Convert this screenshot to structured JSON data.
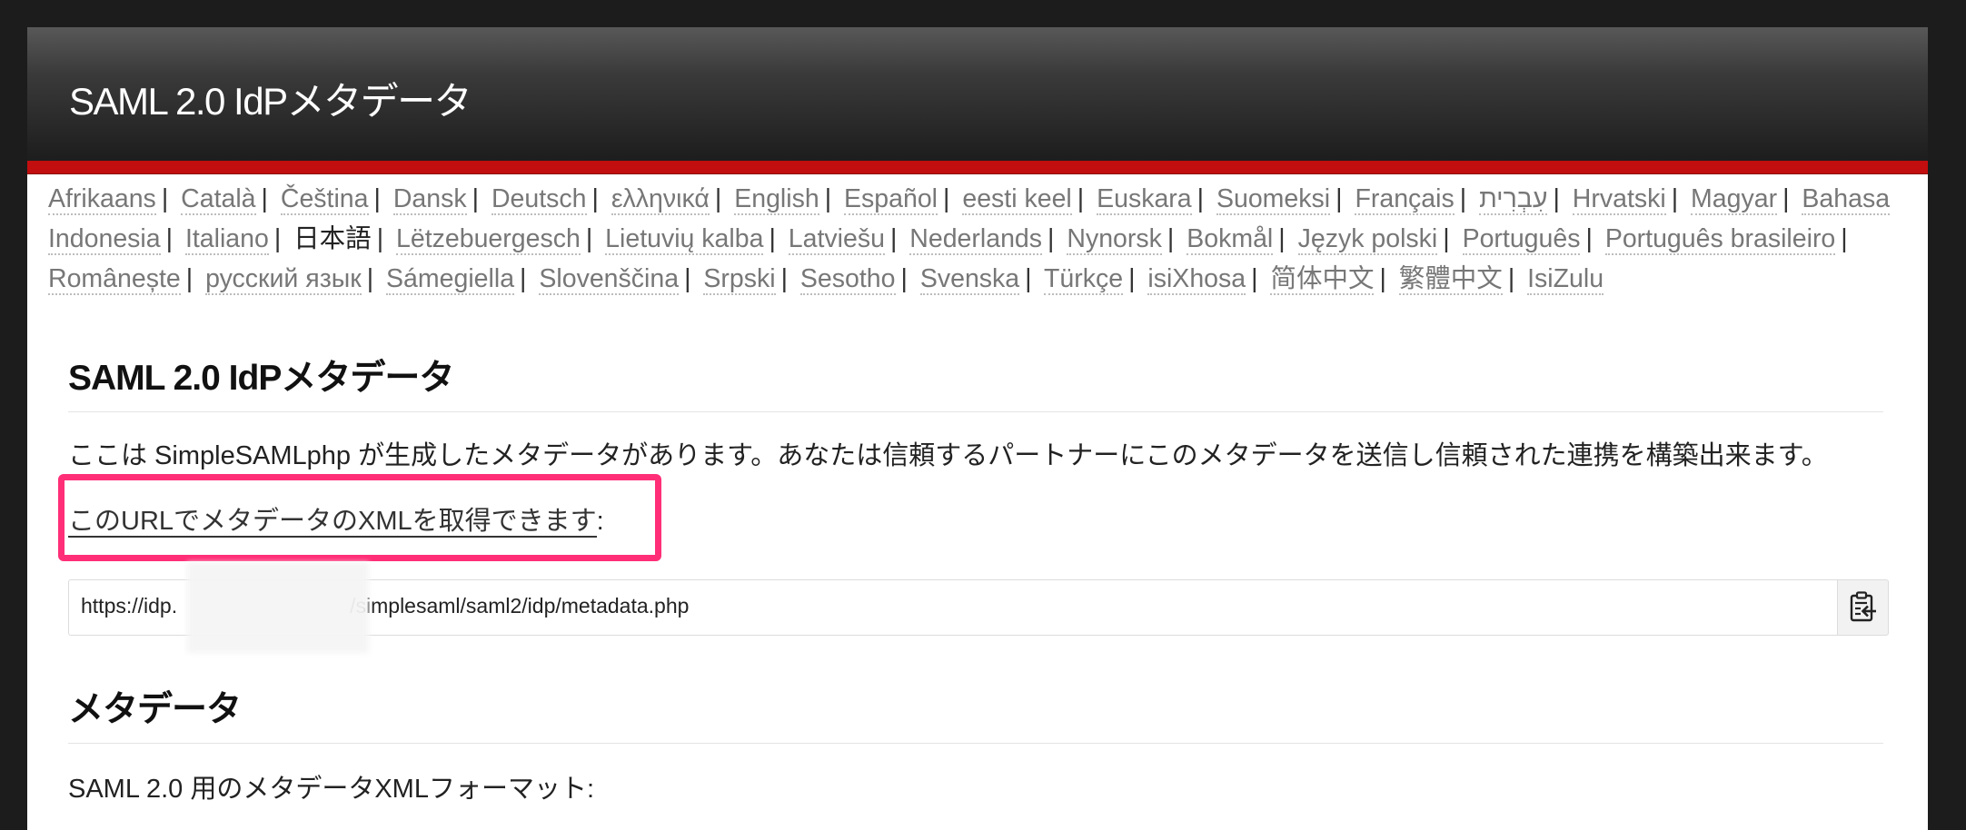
{
  "header": {
    "title": "SAML 2.0 IdPメタデータ"
  },
  "languages": [
    {
      "label": "Afrikaans",
      "current": false
    },
    {
      "label": "Català",
      "current": false
    },
    {
      "label": "Čeština",
      "current": false
    },
    {
      "label": "Dansk",
      "current": false
    },
    {
      "label": "Deutsch",
      "current": false
    },
    {
      "label": "ελληνικά",
      "current": false
    },
    {
      "label": "English",
      "current": false
    },
    {
      "label": "Español",
      "current": false
    },
    {
      "label": "eesti keel",
      "current": false
    },
    {
      "label": "Euskara",
      "current": false
    },
    {
      "label": "Suomeksi",
      "current": false
    },
    {
      "label": "Français",
      "current": false
    },
    {
      "label": "עִבְרִית",
      "current": false
    },
    {
      "label": "Hrvatski",
      "current": false
    },
    {
      "label": "Magyar",
      "current": false
    },
    {
      "label": "Bahasa Indonesia",
      "current": false
    },
    {
      "label": "Italiano",
      "current": false
    },
    {
      "label": "日本語",
      "current": true
    },
    {
      "label": "Lëtzebuergesch",
      "current": false
    },
    {
      "label": "Lietuvių kalba",
      "current": false
    },
    {
      "label": "Latviešu",
      "current": false
    },
    {
      "label": "Nederlands",
      "current": false
    },
    {
      "label": "Nynorsk",
      "current": false
    },
    {
      "label": "Bokmål",
      "current": false
    },
    {
      "label": "Język polski",
      "current": false
    },
    {
      "label": "Português",
      "current": false
    },
    {
      "label": "Português brasileiro",
      "current": false
    },
    {
      "label": "Românește",
      "current": false
    },
    {
      "label": "русский язык",
      "current": false
    },
    {
      "label": "Sámegiella",
      "current": false
    },
    {
      "label": "Slovenščina",
      "current": false
    },
    {
      "label": "Srpski",
      "current": false
    },
    {
      "label": "Sesotho",
      "current": false
    },
    {
      "label": "Svenska",
      "current": false
    },
    {
      "label": "Türkçe",
      "current": false
    },
    {
      "label": "isiXhosa",
      "current": false
    },
    {
      "label": "简体中文",
      "current": false
    },
    {
      "label": "繁體中文",
      "current": false
    },
    {
      "label": "IsiZulu",
      "current": false
    }
  ],
  "language_separator": "|",
  "main": {
    "title": "SAML 2.0 IdPメタデータ",
    "intro": "ここは SimpleSAMLphp が生成したメタデータがあります。あなたは信頼するパートナーにこのメタデータを送信し信頼された連携を構築出来ます。",
    "url_link_label": "このURLでメタデータのXMLを取得できます",
    "url_label_suffix": ":",
    "metadata_url_prefix": "https://idp.",
    "metadata_url_suffix": "/simplesaml/saml2/idp/metadata.php",
    "copy_icon": "clipboard-copy-icon",
    "highlight_color": "#ff2e77"
  },
  "metadata_section": {
    "title": "メタデータ",
    "format_text": "SAML 2.0 用のメタデータXMLフォーマット:"
  },
  "colors": {
    "accent_red": "#c20e0e",
    "header_dark": "#1d1d1d"
  }
}
